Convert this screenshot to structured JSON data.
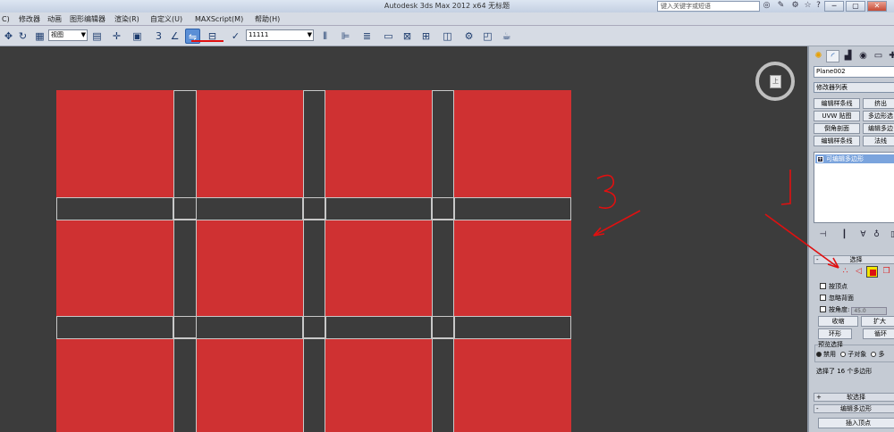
{
  "window": {
    "title": "Autodesk 3ds Max  2012 x64      无标题",
    "search_placeholder": "键入关键字或短语",
    "buttons": [
      "─",
      "▢",
      "✕"
    ]
  },
  "menu": {
    "items": [
      "C)",
      "修改器",
      "动画",
      "图形编辑器",
      "渲染(R)",
      "自定义(U)",
      "MAXScript(M)",
      "帮助(H)"
    ]
  },
  "toolbar": {
    "selection_filter": "视图",
    "named_selection": "11111"
  },
  "viewport": {
    "viewcube_label": "上"
  },
  "command_panel": {
    "object_name": "Plane002",
    "modifier_list": "修改器列表",
    "modifier_buttons": [
      "编辑样条线",
      "挤出",
      "UVW 贴图",
      "多边形选",
      "倒角剖面",
      "编辑多边",
      "编辑样条线",
      "法线"
    ],
    "stack_item": "可编辑多边形",
    "selection_rollout": {
      "title": "选择",
      "sign": "-",
      "by_vertex": "按顶点",
      "ignore_backfacing": "忽略背面",
      "by_angle": "按角度:",
      "angle_value": "45.0",
      "shrink": "收缩",
      "grow": "扩大",
      "ring": "环形",
      "loop": "循环",
      "preview_label": "预览选择",
      "preview_disabled": "禁用",
      "preview_subobject": "子对象",
      "preview_multi": "多",
      "status": "选择了 16 个多边形"
    },
    "soft_selection": {
      "sign": "+",
      "title": "软选择"
    },
    "edit_polygons": {
      "sign": "-",
      "title": "编辑多边形"
    },
    "insert_vertex": "插入顶点"
  },
  "annotations": {
    "handwritten_1": "1",
    "handwritten_3": "3",
    "arrow_color": "#e01010"
  },
  "colors": {
    "viewport_bg": "#3c3c3c",
    "polygon_selected": "#cf3132",
    "wire": "#c8c8c8",
    "ui_bg": "#d6dbe4"
  }
}
